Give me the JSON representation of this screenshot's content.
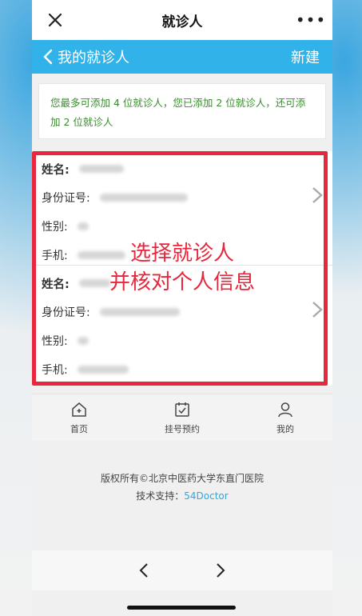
{
  "topbar": {
    "title": "就诊人",
    "more": "•••"
  },
  "header": {
    "back_label": "我的就诊人",
    "new_label": "新建"
  },
  "notice": {
    "text": "您最多可添加 4 位就诊人，您已添加 2 位就诊人，还可添加 2 位就诊人"
  },
  "patients": [
    {
      "name_label": "姓名:",
      "id_label": "身份证号:",
      "gender_label": "性别:",
      "phone_label": "手机:"
    },
    {
      "name_label": "姓名:",
      "id_label": "身份证号:",
      "gender_label": "性别:",
      "phone_label": "手机:"
    }
  ],
  "overlay": {
    "line1": "选择就诊人",
    "line2": "并核对个人信息"
  },
  "tabs": [
    {
      "label": "首页",
      "icon": "home-icon"
    },
    {
      "label": "挂号预约",
      "icon": "calendar-check-icon"
    },
    {
      "label": "我的",
      "icon": "user-icon"
    }
  ],
  "footer": {
    "copyright": "版权所有©北京中医药大学东直门医院",
    "support_label": "技术支持：",
    "support_link": "54Doctor"
  },
  "colors": {
    "accent": "#31b3ea",
    "frame": "#e8263c",
    "notice_text": "#3a8d2e"
  }
}
